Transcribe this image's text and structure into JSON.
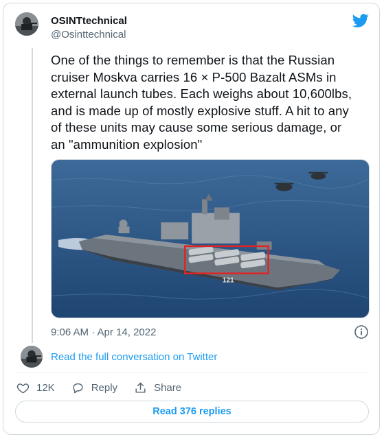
{
  "author": {
    "name": "OSINTtechnical",
    "handle": "@Osinttechnical"
  },
  "tweet": {
    "lines": [
      "One of the things to remember is that the Russian",
      "cruiser Moskva carries 16 × P-500 Bazalt ASMs in",
      "external launch tubes. Each weighs about 10,600lbs,",
      "and is made up of mostly explosive stuff. A hit to any",
      "of these units may cause some serious damage, or",
      "an \"ammunition explosion\""
    ],
    "timestamp": "9:06 AM · Apr 14, 2022"
  },
  "media": {
    "hull_number": "121",
    "highlight_color": "#e02424"
  },
  "links": {
    "read_conversation": "Read the full conversation on Twitter"
  },
  "actions": {
    "like_count": "12K",
    "reply_label": "Reply",
    "share_label": "Share"
  },
  "footer": {
    "read_replies": "Read 376 replies"
  },
  "icons": {
    "brand": "twitter-bird-icon",
    "info": "info-icon",
    "like": "heart-icon",
    "reply": "reply-bubble-icon",
    "share": "share-upload-icon"
  },
  "colors": {
    "accent": "#1d9bf0",
    "text": "#0f1419",
    "secondary": "#536471",
    "border": "#cfd9de"
  }
}
